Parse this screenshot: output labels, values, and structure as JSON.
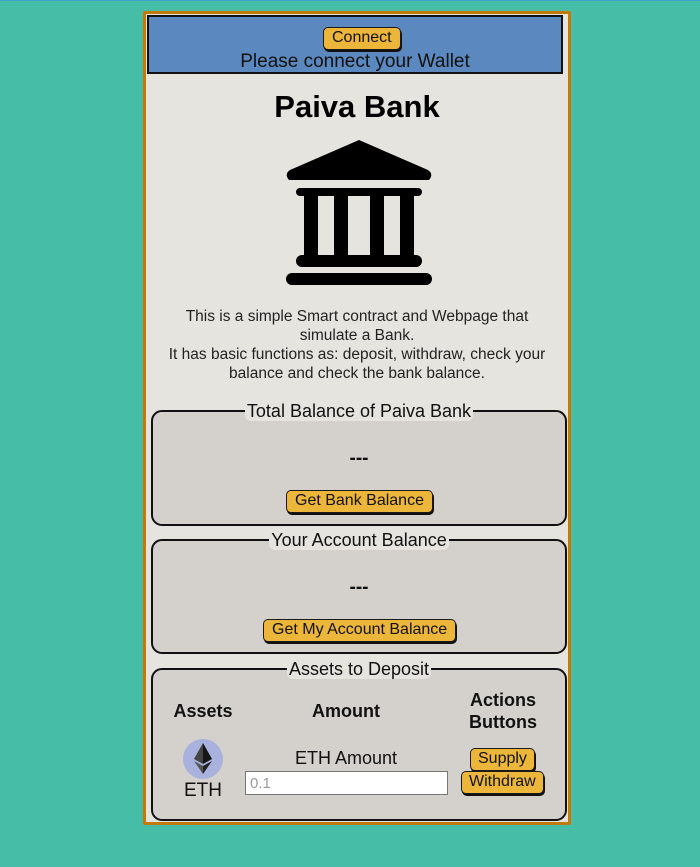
{
  "wallet": {
    "connect_label": "Connect",
    "message": "Please connect your Wallet"
  },
  "title": "Paiva Bank",
  "description": {
    "line1": "This is a simple Smart contract and Webpage that simulate a Bank.",
    "line2": "It has basic functions as: deposit, withdraw, check your balance and check the bank balance."
  },
  "bank_balance": {
    "legend": "Total Balance of Paiva Bank",
    "value": "---",
    "button_label": "Get Bank Balance"
  },
  "account_balance": {
    "legend": "Your Account Balance",
    "value": "---",
    "button_label": "Get My Account Balance"
  },
  "deposit": {
    "legend": "Assets to Deposit",
    "headers": {
      "assets": "Assets",
      "amount": "Amount",
      "actions": "Actions Buttons"
    },
    "asset": {
      "icon": "ethereum-icon",
      "label": "ETH"
    },
    "amount_label": "ETH Amount",
    "amount_placeholder": "0.1",
    "supply_label": "Supply",
    "withdraw_label": "Withdraw"
  },
  "colors": {
    "page_background": "#46bda7",
    "wallet_bar": "#5b88be",
    "button": "#ecb63a",
    "card_border": "#c27a0d"
  }
}
